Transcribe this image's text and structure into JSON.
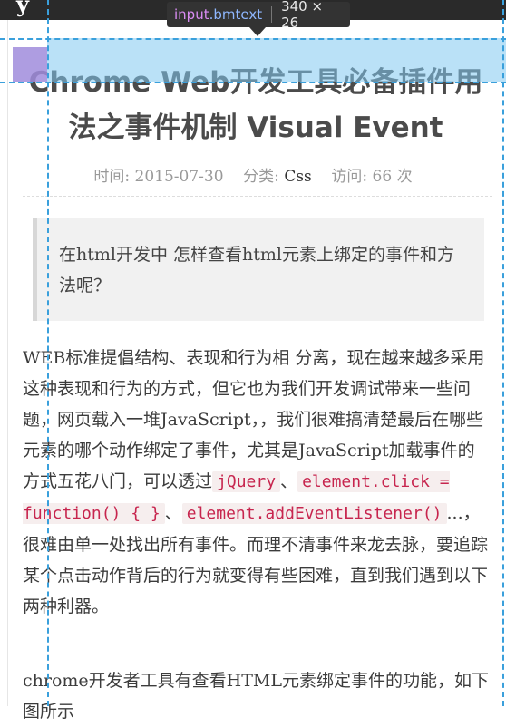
{
  "header": {
    "logo_fragment": "y"
  },
  "inspector": {
    "tag": "input",
    "class_name": ".bmtext",
    "size": "340 × 26"
  },
  "article": {
    "title": "Chrome Web开发工具必备插件用法之事件机制 Visual Event",
    "meta": {
      "time_label": "时间:",
      "time_value": "2015-07-30",
      "category_label": "分类:",
      "category_value": "Css",
      "visits_label": "访问:",
      "visits_value": "66 次"
    },
    "quote": "在html开发中 怎样查看html元素上绑定的事件和方法呢？",
    "para1": {
      "text_a": "WEB标准提倡结构、表现和行为相 分离，现在越来越多采用这种表现和行为的方式，但它也为我们开发调试带来一些问题，网页载入一堆JavaScript，，我们很难搞清楚最后在哪些元素的哪个动作绑定了事件，尤其是JavaScript加载事件的方式五花八门，可以透过",
      "code1": "jQuery",
      "sep1": "、",
      "code2": "element.click = function() { }",
      "sep2": "、",
      "code3": "element.addEventListener()",
      "text_b": "...，很难由单一处找出所有事件。而理不清事件来龙去脉，要追踪某个点击动作背后的行为就变得有些困难，直到我们遇到以下两种利器。"
    },
    "para2": "chrome开发者工具有查看HTML元素绑定事件的功能，如下图所示"
  }
}
